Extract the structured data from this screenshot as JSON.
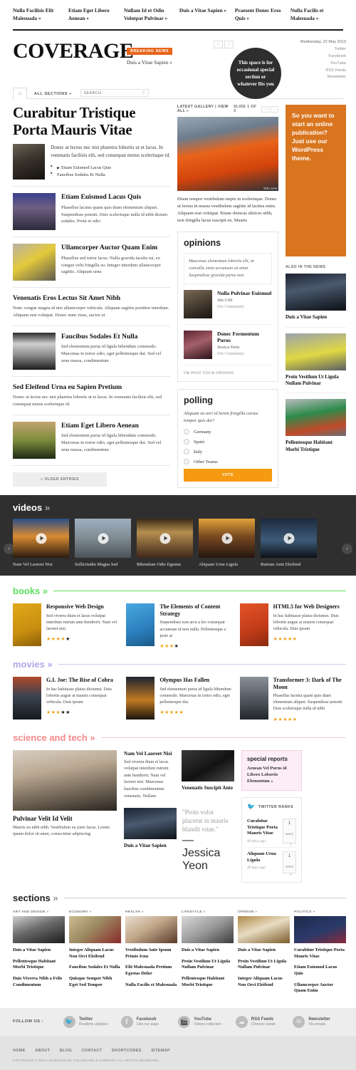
{
  "topnav": [
    {
      "label": "Nulla Facilisis Elit Malesuada »"
    },
    {
      "label": "Etiam Eget Libero Aenean »"
    },
    {
      "label": "Nullam Id et Odio Volutpat Pulvinar »"
    },
    {
      "label": "Duis a Vitae Sapien »"
    },
    {
      "label": "Praesent Donec Eros Quis »"
    },
    {
      "label": "Nulla Facilis et Malesuada »"
    }
  ],
  "masthead": {
    "logo": "COVERAGE",
    "breaking_badge": "BREAKING NEWS",
    "breaking_headline": "Duis a Vitae Sapien »",
    "prev_arrow": "‹",
    "next_arrow": "›",
    "blob_text": "This space is for occasional special section or whatever fits you",
    "date": "Wednesday, 22 May 2013",
    "social": [
      "Twitter",
      "Facebook",
      "YouTube",
      "RSS Feeds",
      "Newsletter"
    ]
  },
  "secbar": {
    "home_icon": "home-icon",
    "all_sections": "ALL SECTIONS »",
    "search_placeholder": "SEARCH",
    "search_value": ""
  },
  "main": {
    "lead": {
      "title": "Curabitur Tristique Porta Mauris Vitae",
      "excerpt": "Donec at lectus nec nisi pharetra lobortis ut et lacus. In venenatis facilisis elit, sed consequat metus scelerisque id.",
      "sublinks": [
        {
          "label": "Etiam Euismod Lacus Quis",
          "video": true
        },
        {
          "label": "Faucibus Sodales Et Nulla",
          "video": false
        }
      ]
    },
    "stories": [
      {
        "title": "Etiam Euismod Lacus Quis",
        "excerpt": "Phasellus lacinia quam quis diam elementum aliquet. Suspendisse potenti. Duis scelerisque nulla id nibh dictum sodales. Proin et odio",
        "has_photo": true
      },
      {
        "title": "Ullamcorper Auctor Quam Enim",
        "excerpt": "Phasellus sed tortor lacus. Nulla gravida iaculis mi, eu congue velit fringilla eu. Integer interdum ullamcorper sagittis. Aliquam urna",
        "has_photo": true
      },
      {
        "title": "Venenatis Eros Lectus Sit Amet Nibh",
        "excerpt": "Nunc congue magna id nisi ullamcorper vehicula. Aliquam sagittis porttitor interdum. Aliquam erat volutpat. Donec nunc risus, auctor ut",
        "has_photo": false
      },
      {
        "title": "Faucibus Sodales Et Nulla",
        "excerpt": "Sed elementum purus id ligula bibendum commodo. Maecenas in tortor odio, eget pellentesque dui. Sed vel urna massa, condimentum",
        "has_photo": true
      },
      {
        "title": "Sed Eleifend Urna eu Sapien Pretium",
        "excerpt": "Donec at lectus nec nisi pharetra lobortis ut et lacus. In venenatis facilisis elit, sed consequat metus scelerisque id.",
        "has_photo": false
      },
      {
        "title": "Etiam Eget Libero Aenean",
        "excerpt": "Sed elementum purus id ligula bibendum commodo. Maecenas in tortor odio, eget pellentesque dui. Sed vel urna massa, condimentum",
        "has_photo": true
      }
    ],
    "older_entries": "« OLDER ENTRIES"
  },
  "gallery": {
    "label": "LATEST GALLERY | VIEW ALL »",
    "slide_counter": "SLIDE 1 OF 3",
    "prev": "‹",
    "next": "›",
    "credit": "RSU SAN",
    "caption": "Etiam tempor vestibulum turpis in scelerisque. Donec ut lectus in massa vestibulum sagittis id lacinia enim. Aliquam erat volutpat. Etiam rhoncus ultrices nibh, non fringilla lacus suscipit eu. Mauris"
  },
  "opinions": {
    "heading": "opinions",
    "quote": "Maecenas elementum lobortis elit, in convallis enim accumsan sit amet. Suspendisse gravida purus non",
    "items": [
      {
        "title": "Nulla Pulvinar Euismod",
        "author": "Jim Crib",
        "comments": "(No Comments)"
      },
      {
        "title": "Donec Fermentum Purus",
        "author": "Jessica Yeon",
        "comments": "(No Comments)"
      }
    ],
    "post_link": "OR POST YOUR OPINION"
  },
  "polling": {
    "heading": "polling",
    "question": "Aliquam eu orci id lorem fringilla cursus tempor quis dui?",
    "options": [
      "Germany",
      "Spain",
      "Italy",
      "Other Teams"
    ],
    "vote_button": "VOTE"
  },
  "right": {
    "ad_text": "So you want to start an online publication? Just use our WordPress theme.",
    "ad_color": "#d9751f",
    "also_heading": "ALSO IN THE NEWS",
    "also_items": [
      {
        "title": "Duis a Vitae Sapien"
      },
      {
        "title": "Proin Vestilum Ut Ligula Nullam Pulvinar"
      },
      {
        "title": "Pellentesque Habitant Morbi Tristique"
      }
    ]
  },
  "videos": {
    "heading": "videos",
    "chevron": "»",
    "prev": "‹",
    "next": "›",
    "items": [
      {
        "title": "Nam Vel Laoreet Nisi"
      },
      {
        "title": "Sollicitudin Magna Sed"
      },
      {
        "title": "Bibendum Odio Egestas"
      },
      {
        "title": "Aliquam Urna Ligula"
      },
      {
        "title": "Rutrum Ante Eleifend"
      }
    ]
  },
  "books": {
    "heading": "books",
    "chevron": "»",
    "accent": "#5ee05e",
    "items": [
      {
        "title": "Responsive Web Design",
        "excerpt": "Sed viverra diam et lacus volutpat interdum rutrum ante hendrerit. Nam vel laoreet nisi.",
        "stars_on": 4,
        "stars_off": 1
      },
      {
        "title": "The Elements of Content Strategy",
        "excerpt": "Suspendisse non arcu a leo consequat accumsan id non nulla. Pellentesque a justo at",
        "stars_on": 3,
        "stars_off": 1
      },
      {
        "title": "HTML5 for Web Designers",
        "excerpt": "In hac habitasse platea dictumst. Duis lobortis augue at mauris consequat vehicula. Duis ipsum",
        "stars_on": 5,
        "stars_off": 0
      }
    ]
  },
  "movies": {
    "heading": "movies",
    "chevron": "»",
    "accent": "#b0a8e8",
    "items": [
      {
        "title": "G.I. Joe: The Rise of Cobra",
        "excerpt": "In hac habitasse platea dictumst. Duis lobortis augue at mauris consequat vehicula. Duis ipsum",
        "stars_on": 3,
        "stars_off": 2
      },
      {
        "title": "Olympus Has Fallen",
        "excerpt": "Sed elementum purus id ligula bibendum commodo. Maecenas in tortor odio, eget pellentesque dui.",
        "stars_on": 5,
        "stars_off": 0
      },
      {
        "title": "Transformer 3: Dark of The Moon",
        "excerpt": "Phasellus lacinia quam quis diam elementum aliquet. Suspendisse potenti. Duis scelerisque nulla id nibh",
        "stars_on": 5,
        "stars_off": 0
      }
    ]
  },
  "science": {
    "heading": "science and tech",
    "chevron": "»",
    "accent": "#f58a8a",
    "feature": {
      "title": "Pulvinar Velit Id Velit",
      "excerpt": "Mauris eu nibh nibh. Vestibulum eu justo lacus. Lorem ipsum dolor sit amet, consectetur adipiscing"
    },
    "mid_article": {
      "title": "Nam Vel Laoreet Nisi",
      "excerpt": "Sed viverra diam et lacus volutpat interdum rutrum ante hendrerit. Nam vel laoreet nisi. Maecenas faucibus condimentum venenatis. Nullam"
    },
    "small_1": {
      "title": "Venenatis Suscipit Ante"
    },
    "small_2": {
      "title": "Duis a Vitae Sapien"
    },
    "pullquote": "\"Proin volut placerat in mauris blandit vitae.\"",
    "pullquote_by": "— Jessica Yeon",
    "special": {
      "heading": "special reports",
      "text": "Aenean Vel Purus id Libero Lobortis Elementum »"
    },
    "twitter": {
      "heading": "TWITTER RANKS",
      "items": [
        {
          "title": "Curabitur Tristique Porta Mauris Vitae",
          "ago": "40 days ago",
          "count": "1",
          "unit": "tweet"
        },
        {
          "title": "Aliquam Urna Ligula",
          "ago": "40 days ago",
          "count": "1",
          "unit": "tweet"
        }
      ]
    }
  },
  "sections": {
    "heading": "sections",
    "chevron": "»",
    "columns": [
      {
        "label": "ART AND DESIGN »",
        "links": [
          "Duis a Vitae Sapien",
          "Pellentesque Habitant Morbi Tristique",
          "Duis Viverra Nibh a Felis Condimentum"
        ]
      },
      {
        "label": "ECONOMY »",
        "links": [
          "Integer Aliquam Lacus Non Orci Eleifend",
          "Faucibus Sodales Et Nulla",
          "Quisque Semper Nibh Eget Sed Tempor"
        ]
      },
      {
        "label": "HEALTH »",
        "links": [
          "Vestibulum Ante Ipsum Primis Icnu",
          "Elit Malesuada Pretium Egestas Dolor",
          "Nulla Facilis et Malesuada"
        ]
      },
      {
        "label": "LIFESTYLE »",
        "links": [
          "Duis a Vitae Sapien",
          "Proin Vestilum Ut Ligula Nullam Pulvinar",
          "Pellentesque Habitant Morbi Tristique"
        ]
      },
      {
        "label": "OPINION »",
        "links": [
          "Duis a Vitae Sapien",
          "Proin Vestilum Ut Ligula Nullam Pulvinar",
          "Integer Aliquam Lacus Non Orci Eleifend"
        ]
      },
      {
        "label": "POLITICS »",
        "links": [
          "Curabitur Tristique Porta Mauris Vitae",
          "Etiam Euismod Lacus Quis",
          "Ullamcorper Auctor Quam Enim"
        ]
      }
    ]
  },
  "footer": {
    "follow_label": "FOLLOW US :",
    "socials": [
      {
        "name": "Twitter",
        "sub": "Realtime updates",
        "icon": "twitter-icon"
      },
      {
        "name": "Facebook",
        "sub": "Like our page",
        "icon": "facebook-icon"
      },
      {
        "name": "YouTube",
        "sub": "Videos collection",
        "icon": "youtube-icon"
      },
      {
        "name": "RSS Feeds",
        "sub": "Choose canals",
        "icon": "rss-icon"
      },
      {
        "name": "Newsletter",
        "sub": "Via emails",
        "icon": "envelope-icon"
      }
    ],
    "links": [
      "HOME",
      "ABOUT",
      "BLOG",
      "CONTACT",
      "SHORTCODES",
      "SITEMAP"
    ],
    "copyright": "COPYRIGHT © 2013 COVERAGE BY COLORLABS & COMPANY. ALL RIGHTS RESERVED."
  }
}
